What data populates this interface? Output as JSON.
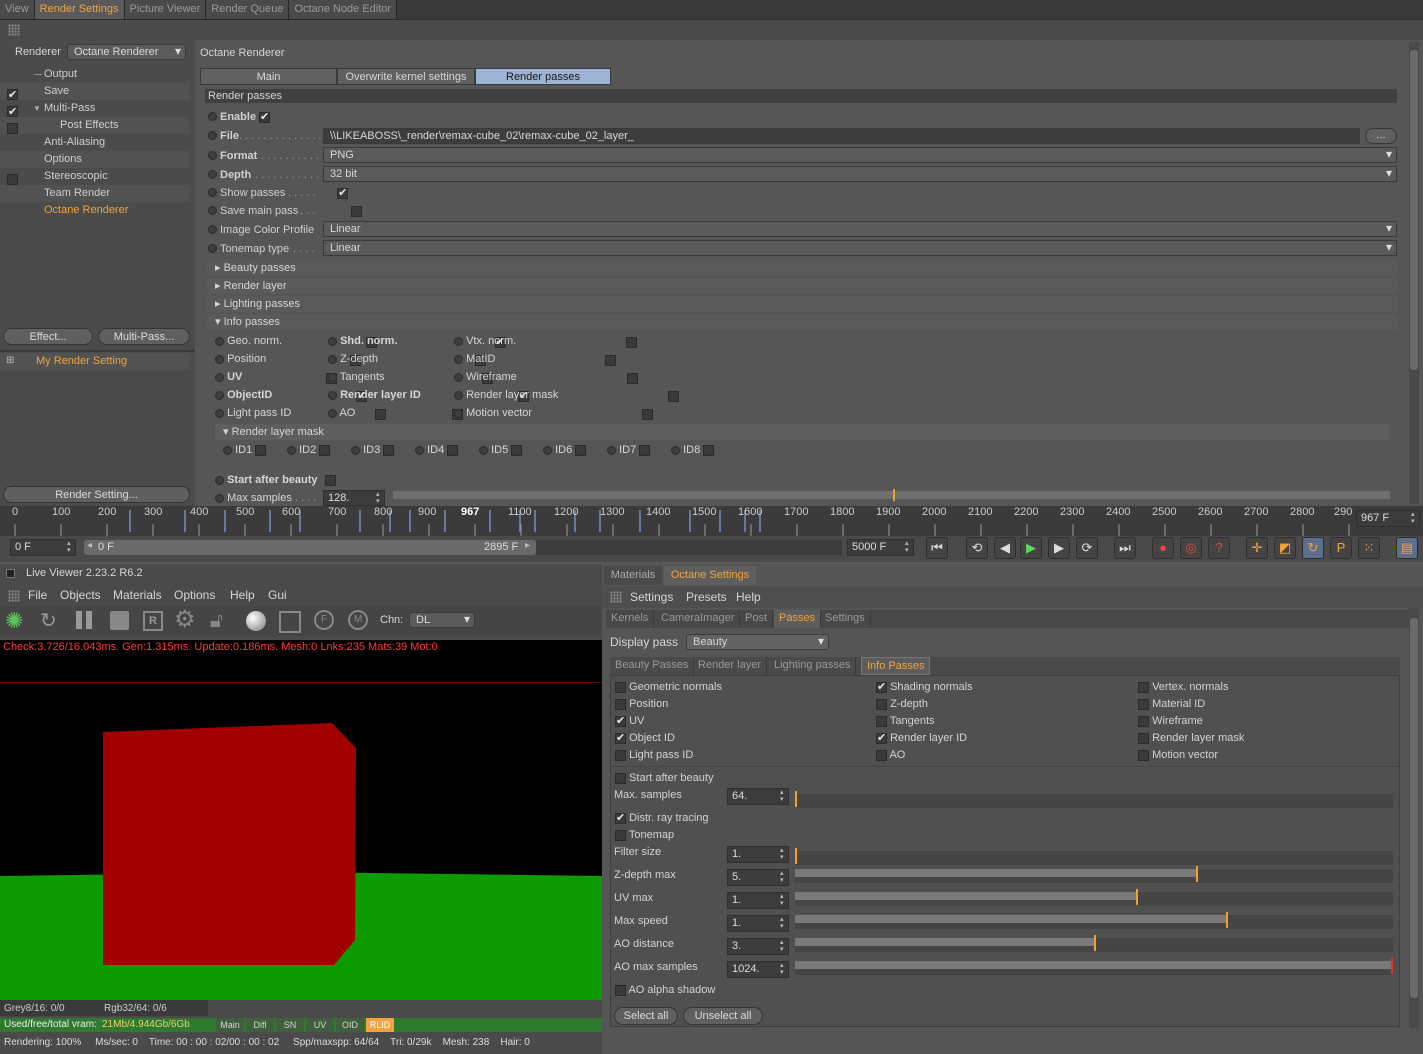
{
  "top_tabs": [
    {
      "label": "View",
      "active": false
    },
    {
      "label": "Render Settings",
      "active": true
    },
    {
      "label": "Picture Viewer",
      "active": false
    },
    {
      "label": "Render Queue",
      "active": false
    },
    {
      "label": "Octane Node Editor",
      "active": false
    }
  ],
  "left_panel": {
    "renderer_label": "Renderer",
    "renderer_value": "Octane Renderer",
    "items": [
      {
        "label": "Output",
        "checked": null
      },
      {
        "label": "Save",
        "checked": true
      },
      {
        "label": "Multi-Pass",
        "checked": true
      },
      {
        "label": "Post Effects",
        "checked": false
      },
      {
        "label": "Anti-Aliasing",
        "checked": null
      },
      {
        "label": "Options",
        "checked": null
      },
      {
        "label": "Stereoscopic",
        "checked": false
      },
      {
        "label": "Team Render",
        "checked": null
      },
      {
        "label": "Octane Renderer",
        "checked": null
      }
    ],
    "effect_button": "Effect...",
    "multipass_button": "Multi-Pass...",
    "setting_name": "My Render Setting",
    "render_setting_button": "Render Setting..."
  },
  "settings_panel": {
    "title": "Octane Renderer",
    "tabs": [
      "Main",
      "Overwrite kernel settings",
      "Render passes"
    ],
    "active_tab": "Render passes",
    "section_title": "Render passes",
    "enable_label": "Enable",
    "file_label": "File",
    "file_value": "\\\\LIKEABOSS\\_render\\remax-cube_02\\remax-cube_02_layer_",
    "file_browse": "...",
    "format_label": "Format",
    "format_value": "PNG",
    "depth_label": "Depth",
    "depth_value": "32 bit",
    "show_passes_label": "Show passes",
    "save_main_label": "Save main pass",
    "icp_label": "Image Color Profile",
    "icp_value": "Linear",
    "tonemap_label": "Tonemap type",
    "tonemap_value": "Linear",
    "groups": [
      "Beauty passes",
      "Render layer",
      "Lighting passes",
      "Info passes"
    ],
    "info_passes": [
      {
        "label": "Geo. norm.",
        "bold": false,
        "checked": false
      },
      {
        "label": "Shd. norm.",
        "bold": true,
        "checked": true
      },
      {
        "label": "Vtx. norm.",
        "bold": false,
        "checked": false
      },
      {
        "label": "Position",
        "bold": false,
        "checked": false
      },
      {
        "label": "Z-depth",
        "bold": false,
        "checked": false
      },
      {
        "label": "MatID",
        "bold": false,
        "checked": false
      },
      {
        "label": "UV",
        "bold": true,
        "checked": true
      },
      {
        "label": "Tangents",
        "bold": false,
        "checked": false
      },
      {
        "label": "Wireframe",
        "bold": false,
        "checked": false
      },
      {
        "label": "ObjectID",
        "bold": true,
        "checked": true
      },
      {
        "label": "Render layer ID",
        "bold": true,
        "checked": true
      },
      {
        "label": "Render layer mask",
        "bold": false,
        "checked": false
      },
      {
        "label": "Light pass ID",
        "bold": false,
        "checked": false
      },
      {
        "label": "AO",
        "bold": false,
        "checked": false
      },
      {
        "label": "Motion vector",
        "bold": false,
        "checked": false
      }
    ],
    "render_layer_mask_title": "Render layer mask",
    "ids": [
      "ID1",
      "ID2",
      "ID3",
      "ID4",
      "ID5",
      "ID6",
      "ID7",
      "ID8"
    ],
    "start_after_beauty": "Start after beauty",
    "max_samples_label": "Max samples",
    "max_samples_value": "128."
  },
  "timeline": {
    "ticks": [
      "0",
      "100",
      "200",
      "300",
      "400",
      "500",
      "600",
      "700",
      "800",
      "900",
      "967",
      "1100",
      "1200",
      "1300",
      "1400",
      "1500",
      "1600",
      "1700",
      "1800",
      "1900",
      "2000",
      "2100",
      "2200",
      "2300",
      "2400",
      "2500",
      "2600",
      "2700",
      "2800",
      "290"
    ],
    "current_frame_box": "967 F",
    "start_frame": "0 F",
    "range_start": "0 F",
    "range_end": "2895 F",
    "end_frame": "5000 F"
  },
  "live_viewer": {
    "title": "Live Viewer 2.23.2 R6.2",
    "menu": [
      "File",
      "Objects",
      "Materials",
      "Options",
      "Help",
      "Gui"
    ],
    "channel_label": "Chn:",
    "channel_value": "DL",
    "stats_line": "Check:3.726/16.043ms. Gen:1.315ms. Update:0.186ms. Mesh:0 Lnks:235 Mats:39 Mot:0",
    "grey_label": "Grey8/16: 0/0",
    "rgb_label": "Rgb32/64: 0/6",
    "vram_label": "Used/free/total vram:",
    "vram_value": "21Mb/4.944Gb/6Gb",
    "pass_tabs": [
      "Main",
      "Difl",
      "SN",
      "UV",
      "OID",
      "RLID"
    ],
    "status": "Rendering: 100%     Ms/sec: 0    Time: 00 : 00 : 02/00 : 00 : 02     Spp/maxspp: 64/64    Tri: 0/29k    Mesh: 238    Hair: 0"
  },
  "octane_settings": {
    "window_tabs": [
      "Materials",
      "Octane Settings"
    ],
    "menu": [
      "Settings",
      "Presets",
      "Help"
    ],
    "tabs": [
      "Kernels",
      "CameraImager",
      "Post",
      "Passes",
      "Settings"
    ],
    "active_tab": "Passes",
    "display_pass_label": "Display pass",
    "display_pass_value": "Beauty",
    "subtabs": [
      "Beauty Passes",
      "Render layer",
      "Lighting passes",
      "Info Passes"
    ],
    "active_subtab": "Info Passes",
    "passes": [
      {
        "label": "Geometric normals",
        "checked": false
      },
      {
        "label": "Shading normals",
        "checked": true
      },
      {
        "label": "Vertex. normals",
        "checked": false
      },
      {
        "label": "Position",
        "checked": false
      },
      {
        "label": "Z-depth",
        "checked": false
      },
      {
        "label": "Material ID",
        "checked": false
      },
      {
        "label": "UV",
        "checked": true
      },
      {
        "label": "Tangents",
        "checked": false
      },
      {
        "label": "Wireframe",
        "checked": false
      },
      {
        "label": "Object ID",
        "checked": true
      },
      {
        "label": "Render layer ID",
        "checked": true
      },
      {
        "label": "Render layer mask",
        "checked": false
      },
      {
        "label": "Light pass ID",
        "checked": false
      },
      {
        "label": "AO",
        "checked": false
      },
      {
        "label": "Motion vector",
        "checked": false
      }
    ],
    "start_after_beauty": "Start after beauty",
    "distr_ray": "Distr. ray tracing",
    "tonemap": "Tonemap",
    "ao_alpha": "AO alpha shadow",
    "sliders": [
      {
        "label": "Max. samples",
        "value": "64.",
        "fraction": 0.0
      },
      {
        "label": "Filter size",
        "value": "1.",
        "fraction": 0.0
      },
      {
        "label": "Z-depth max",
        "value": "5.",
        "fraction": 0.67
      },
      {
        "label": "UV max",
        "value": "1.",
        "fraction": 0.57
      },
      {
        "label": "Max speed",
        "value": "1.",
        "fraction": 0.72
      },
      {
        "label": "AO distance",
        "value": "3.",
        "fraction": 0.5
      },
      {
        "label": "AO max samples",
        "value": "1024.",
        "fraction": 1.0
      }
    ],
    "select_all": "Select all",
    "unselect_all": "Unselect all"
  }
}
